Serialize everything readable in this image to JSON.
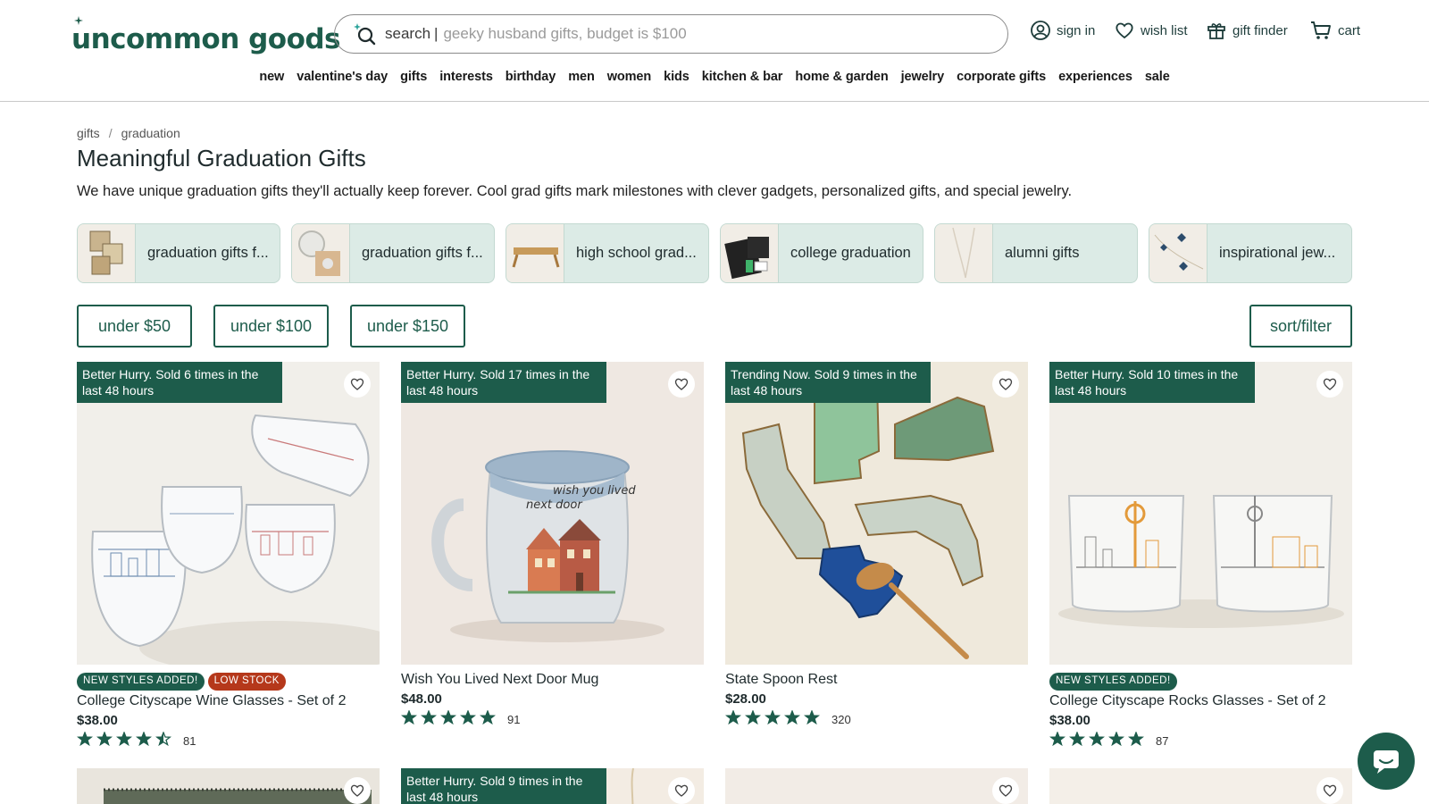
{
  "brand": {
    "name": "uncommon goods",
    "color": "#1d5c4b"
  },
  "search": {
    "label": "search",
    "separator": "|",
    "placeholder": "geeky husband gifts, budget is $100"
  },
  "utility": {
    "sign_in": "sign in",
    "wish_list": "wish list",
    "gift_finder": "gift finder",
    "cart": "cart"
  },
  "nav": [
    "new",
    "valentine's day",
    "gifts",
    "interests",
    "birthday",
    "men",
    "women",
    "kids",
    "kitchen & bar",
    "home & garden",
    "jewelry",
    "corporate gifts",
    "experiences",
    "sale"
  ],
  "breadcrumb": {
    "items": [
      "gifts",
      "graduation"
    ],
    "separator": "/"
  },
  "page": {
    "title": "Meaningful Graduation Gifts",
    "description": "We have unique graduation gifts they'll actually keep forever. Cool grad gifts mark milestones with clever gadgets, personalized gifts, and special jewelry."
  },
  "categories": [
    "graduation gifts f...",
    "graduation gifts f...",
    "high school grad...",
    "college graduation",
    "alumni gifts",
    "inspirational jew..."
  ],
  "price_filters": [
    "under $50",
    "under $100",
    "under $150"
  ],
  "sort_filter": "sort/filter",
  "products": [
    {
      "badge": "Better Hurry. Sold 6 times in the last 48 hours",
      "tags": [
        "NEW STYLES ADDED!",
        "LOW STOCK"
      ],
      "name": "College Cityscape Wine Glasses - Set of 2",
      "price": "$38.00",
      "rating": 4.5,
      "reviews": "81",
      "image": "wine-glasses"
    },
    {
      "badge": "Better Hurry. Sold 17 times in the last 48 hours",
      "tags": [],
      "name": "Wish You Lived Next Door Mug",
      "price": "$48.00",
      "rating": 5,
      "reviews": "91",
      "image": "mug"
    },
    {
      "badge": "Trending Now. Sold 9 times in the last 48 hours",
      "tags": [],
      "name": "State Spoon Rest",
      "price": "$28.00",
      "rating": 5,
      "reviews": "320",
      "image": "spoon-rest"
    },
    {
      "badge": "Better Hurry. Sold 10 times in the last 48 hours",
      "tags": [
        "NEW STYLES ADDED!"
      ],
      "name": "College Cityscape Rocks Glasses - Set of 2",
      "price": "$38.00",
      "rating": 5,
      "reviews": "87",
      "image": "rocks-glasses"
    }
  ],
  "next_row": [
    {
      "badge": ""
    },
    {
      "badge": "Better Hurry. Sold 9 times in the last 48 hours"
    },
    {
      "badge": ""
    },
    {
      "badge": ""
    }
  ],
  "mug_text": [
    "wish you lived",
    "next door"
  ],
  "colors": {
    "accent": "#1d5c4b",
    "low_stock": "#b5381b",
    "chip_bg": "#dcebe6",
    "star": "#1d5c4b"
  }
}
